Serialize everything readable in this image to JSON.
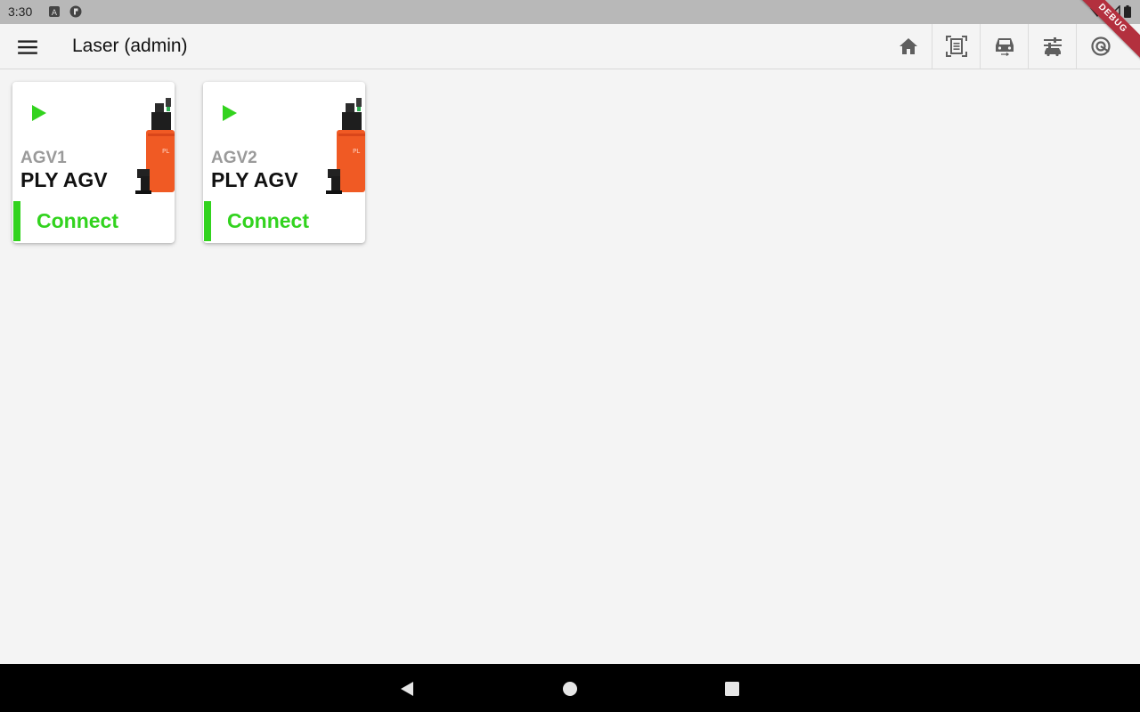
{
  "status_bar": {
    "time": "3:30"
  },
  "debug_banner": "DEBUG",
  "app_bar": {
    "title": "Laser (admin)",
    "actions": [
      "home-icon",
      "document-scan-icon",
      "vehicle-icon",
      "tune-vehicle-icon",
      "target-icon"
    ]
  },
  "colors": {
    "accent_green": "#32d31e",
    "ribbon": "#b3303e"
  },
  "cards": [
    {
      "id": "AGV1",
      "name": "PLY AGV",
      "action": "Connect"
    },
    {
      "id": "AGV2",
      "name": "PLY AGV",
      "action": "Connect"
    }
  ]
}
